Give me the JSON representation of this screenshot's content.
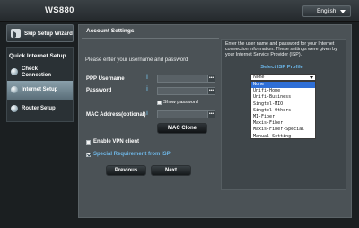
{
  "header": {
    "model": "WS880",
    "language": "English"
  },
  "sidebar": {
    "skip_label": "Skip Setup Wizard",
    "section_title": "Quick Internet Setup",
    "items": [
      {
        "line1": "Check",
        "line2": "Connection"
      },
      {
        "line1": "Internet Setup",
        "line2": ""
      },
      {
        "line1": "Router Setup",
        "line2": ""
      }
    ]
  },
  "main": {
    "title": "Account Settings",
    "prompt": "Please enter your username and password",
    "fields": {
      "username_label": "PPP Username",
      "password_label": "Password",
      "mac_label": "MAC Address(optional)",
      "info_icon": "i",
      "picker_glyph": "•••"
    },
    "show_password_label": "Show password",
    "mac_clone_label": "MAC Clone",
    "vpn_label": "Enable VPN client",
    "special_req_label": "Special Requirement from ISP",
    "previous_label": "Previous",
    "next_label": "Next"
  },
  "isp_panel": {
    "note": "Enter the user name and password for your Internet connection information. These settings were given by your Internet Service Provider (ISP).",
    "select_label": "Select ISP Profile",
    "selected_value": "None",
    "options": [
      "None",
      "Unifi-Home",
      "Unifi-Business",
      "Singtel-MIO",
      "Singtel-Others",
      "M1-Fiber",
      "Maxis-Fiber",
      "Maxis-Fiber-Special",
      "Manual Setting"
    ]
  },
  "colors": {
    "accent_blue": "#6fb8e8",
    "active_nav": "#7d929d",
    "panel": "#4b5256",
    "selected_option": "#2f6fd6"
  },
  "checkboxes": {
    "show_password": false,
    "enable_vpn": false,
    "special_requirement": true
  }
}
